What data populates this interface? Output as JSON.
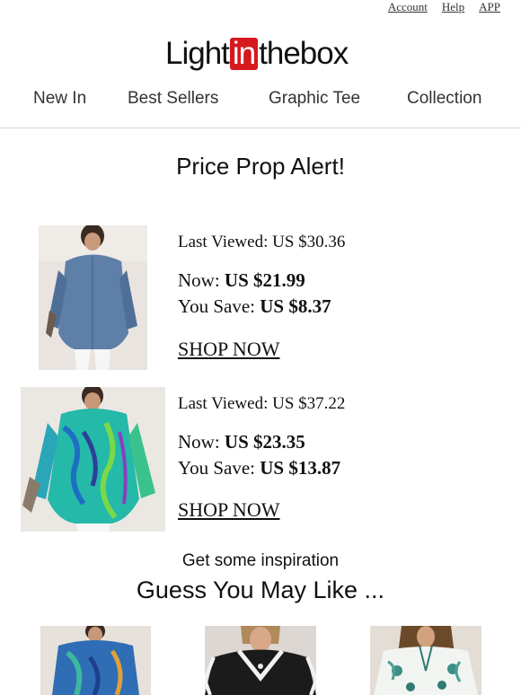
{
  "header": {
    "links": [
      "Account",
      "Help",
      "APP"
    ],
    "logo": {
      "part1": "Light",
      "part2": "in",
      "part3": "thebox"
    }
  },
  "nav": {
    "items": [
      "New In",
      "Best Sellers",
      "Graphic Tee",
      "Collection"
    ]
  },
  "alert": {
    "title": "Price Prop Alert!"
  },
  "products": [
    {
      "last_viewed": "Last Viewed: US $30.36",
      "now_label": "Now: ",
      "now_price": "US $21.99",
      "save_label": "You Save: ",
      "save_amount": "US $8.37",
      "shop": "SHOP NOW"
    },
    {
      "last_viewed": "Last Viewed: US $37.22",
      "now_label": "Now: ",
      "now_price": "US $23.35",
      "save_label": "You Save: ",
      "save_amount": "US $13.87",
      "shop": "SHOP NOW"
    }
  ],
  "inspiration": {
    "subtitle": "Get some inspiration",
    "title": "Guess You May Like ..."
  },
  "colors": {
    "brand_red": "#d6181f",
    "text": "#111111"
  }
}
